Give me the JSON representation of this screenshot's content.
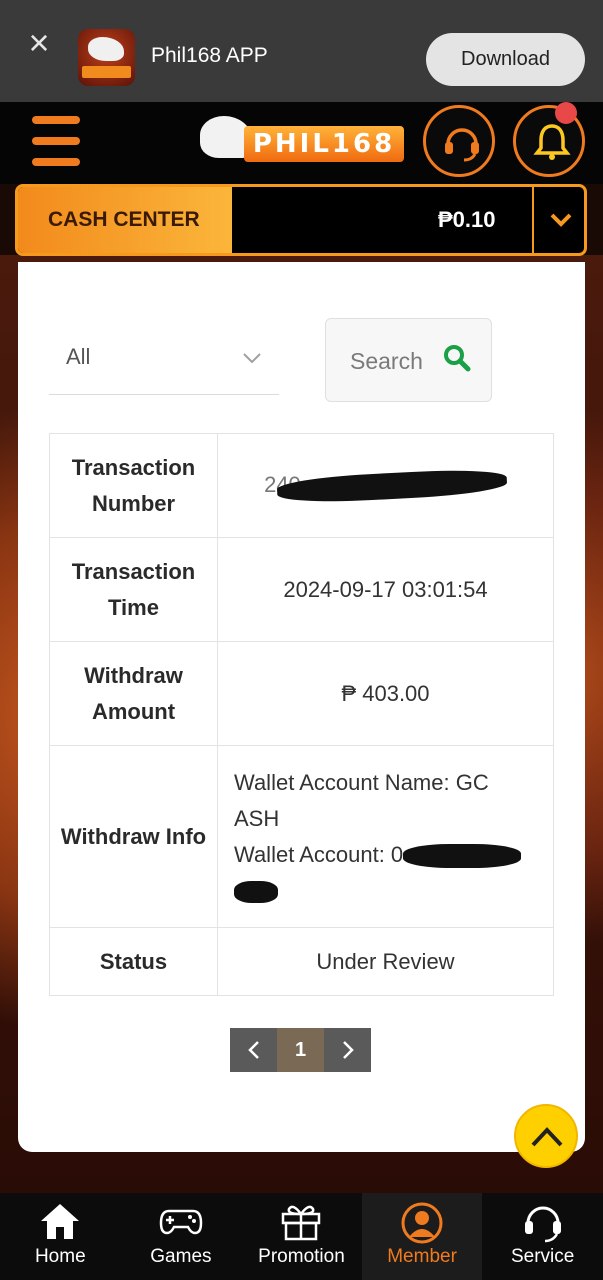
{
  "app_banner": {
    "close_icon": "close-icon",
    "app_name": "Phil168 APP",
    "download_label": "Download"
  },
  "header": {
    "menu_icon": "hamburger-menu-icon",
    "logo_text": "PHIL168",
    "support_icon": "headset-icon",
    "notification_icon": "bell-icon",
    "accent_color": "#f07b1e"
  },
  "cash_center": {
    "label": "CASH CENTER",
    "balance": "₱0.10",
    "toggle_icon": "chevron-down-icon"
  },
  "filter": {
    "selected": "All",
    "search_label": "Search"
  },
  "transaction": {
    "rows": [
      {
        "label": "Transaction Number",
        "value": "240"
      },
      {
        "label": "Transaction Time",
        "value": "2024-09-17 03:01:54"
      },
      {
        "label": "Withdraw Amount",
        "value": "₱ 403.00"
      },
      {
        "label": "Withdraw Info",
        "wallet_name_label": "Wallet Account Name: GC",
        "wallet_name_rest": "ASH",
        "wallet_account_label": "Wallet Account: 0"
      },
      {
        "label": "Status",
        "value": "Under Review"
      }
    ]
  },
  "pagination": {
    "prev_icon": "chevron-left-icon",
    "current_page": "1",
    "next_icon": "chevron-right-icon"
  },
  "bottom_nav": [
    {
      "label": "Home",
      "icon": "home-icon"
    },
    {
      "label": "Games",
      "icon": "gamepad-icon"
    },
    {
      "label": "Promotion",
      "icon": "gift-icon"
    },
    {
      "label": "Member",
      "icon": "member-avatar-icon",
      "active": true
    },
    {
      "label": "Service",
      "icon": "headset-icon"
    }
  ]
}
